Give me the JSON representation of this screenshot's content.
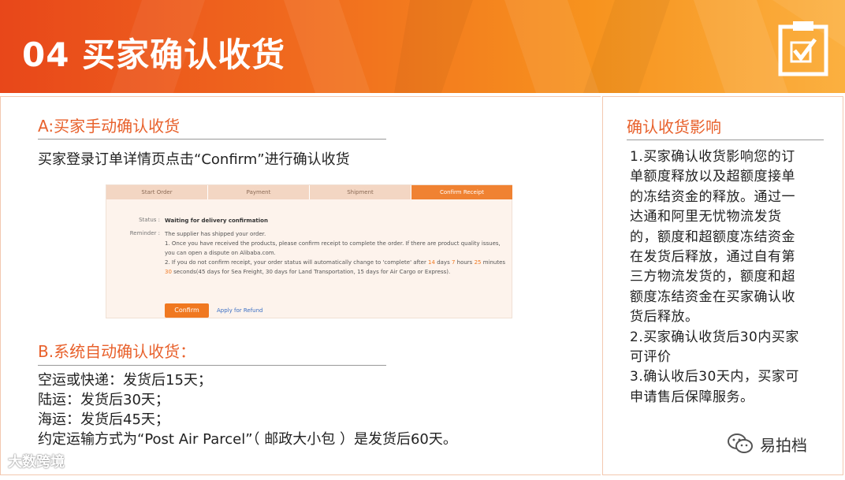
{
  "header": {
    "title": "04 买家确认收货",
    "icon": "clipboard-check-icon"
  },
  "section_a": {
    "title": "A:买家手动确认收货",
    "description": "买家登录订单详情页点击“Confirm”进行确认收货"
  },
  "order_screenshot": {
    "steps": [
      "Start Order",
      "Payment",
      "Shipment",
      "Confirm Receipt"
    ],
    "status_label": "Status :",
    "status_value": "Waiting for delivery confirmation",
    "reminder_label": "Reminder :",
    "reminder_line1": "The supplier has shipped your order.",
    "reminder_line2": "1. Once you have received the products, please confirm receipt to complete the order. If there are product quality issues,",
    "reminder_line3": "you can open a dispute on Alibaba.com.",
    "reminder_line4_a": "2. If you do not confirm receipt, your order status will automatically change to 'complete' after ",
    "days": "14",
    "days_unit": " days ",
    "hours": "7",
    "hours_unit": " hours ",
    "minutes": "25",
    "minutes_unit": " minutes",
    "seconds": "30",
    "reminder_line5": " seconds(45 days for Sea Freight, 30 days for Land Transportation, 15 days for Air Cargo or Express).",
    "confirm_button": "Confirm",
    "refund_link": "Apply for Refund"
  },
  "section_b": {
    "title": "B.系统自动确认收货：",
    "lines": [
      "空运或快递：发货后15天；",
      "陆运：发货后30天；",
      "海运：发货后45天；",
      "约定运输方式为“Post Air Parcel”（ 邮政大小包 ）是发货后60天。"
    ]
  },
  "impact": {
    "title": "确认收货影响",
    "lines": [
      "1.买家确认收货影响您的订",
      "单额度释放以及超额度接单",
      "的冻结资金的释放。通过一",
      "达通和阿里无忧物流发货",
      "的，额度和超额度冻结资金",
      "在发货后释放，通过自有第",
      "三方物流发货的，额度和超",
      "额度冻结资金在买家确认收",
      "货后释放。",
      "2.买家确认收货后30内买家",
      "可评价",
      "3.确认收后30天内，买家可",
      "申请售后保障服务。"
    ]
  },
  "footer": {
    "wechat_name": "易拍档",
    "watermark": "大数跨境"
  },
  "colors": {
    "accent": "#e8612c",
    "banner_start": "#e8471a",
    "banner_end": "#fbb040",
    "button": "#f07820"
  }
}
